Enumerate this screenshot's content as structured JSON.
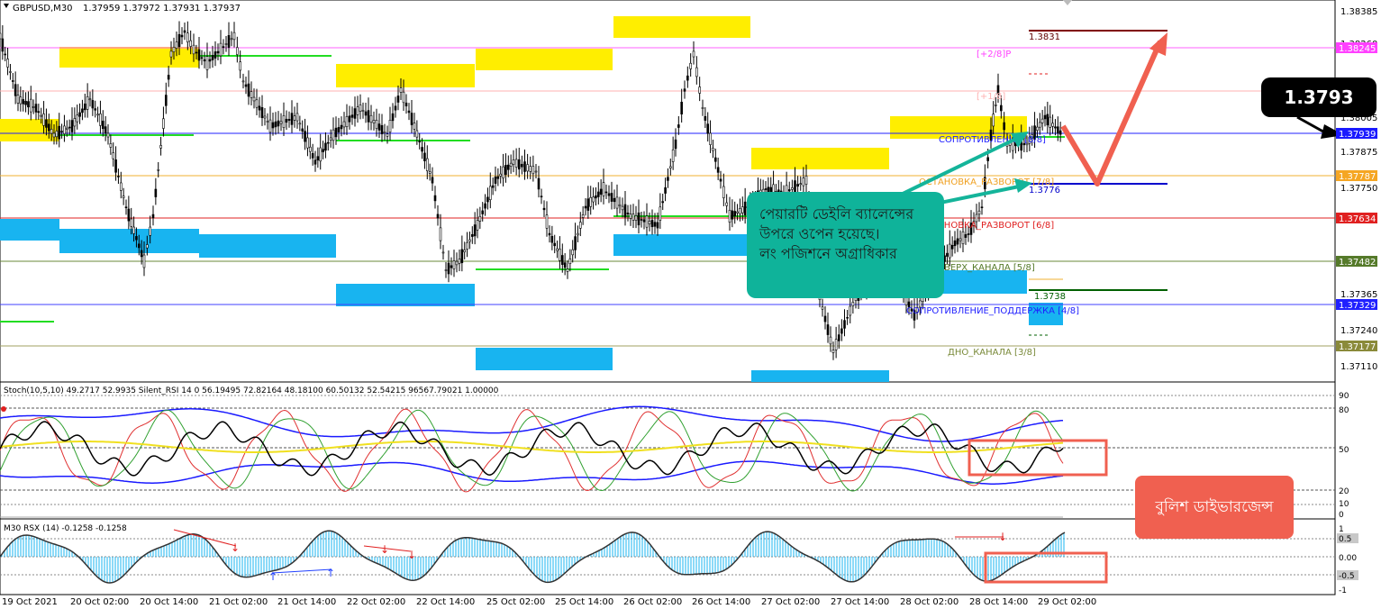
{
  "window": {
    "title": "GBPUSD,M30",
    "ohlc": "1.37959 1.37972 1.37931 1.37937"
  },
  "price_axis": {
    "labels": [
      "1.38385",
      "1.38260",
      "1.38005",
      "1.37875",
      "1.37750",
      "1.37365",
      "1.37240",
      "1.37110"
    ],
    "level_tags": [
      {
        "text": "1.38245",
        "color": "#ff40ff"
      },
      {
        "text": "1.37939",
        "color": "#1a1aff"
      },
      {
        "text": "1.37787",
        "color": "#f5a623"
      },
      {
        "text": "1.37634",
        "color": "#e02020"
      },
      {
        "text": "1.37482",
        "color": "#557a2a"
      },
      {
        "text": "1.37329",
        "color": "#2020ff"
      },
      {
        "text": "1.37177",
        "color": "#8a8a3a"
      }
    ]
  },
  "murrey_labels": {
    "p28": "[+2/8]P",
    "p18": "[+1/8]",
    "resist_8_8": "СОПРОТИВЛЕНИЕ [8/8]",
    "reversal_7_8": "ОСТАНОВКА_РАЗВОРОТ [7/8]",
    "reversal_6_8": "ОСТАНОВКА_РАЗВОРОТ [6/8]",
    "channel_top_5_8": "ВЕРХ_КАНАЛА [5/8]",
    "support_4_8": "СОПРОТИВЛЕНИЕ_ПОДДЕРЖКА [4/8]",
    "channel_bottom_3_8": "ДНО_КАНАЛА [3/8]",
    "level_1_3831": "1.3831",
    "level_1_3776": "1.3776",
    "level_1_3738": "1.3738"
  },
  "indicator1": {
    "header": "Stoch(10,5,10) 49.2717 52.9935  Silent_RSI 14 0 56.19495 72.82164 48.18100 60.50132 52.54215 96567.79021 1.00000",
    "levels": [
      "90",
      "80",
      "50",
      "20",
      "10",
      "0"
    ]
  },
  "indicator2": {
    "header": "M30  RSX (14) -0.1258 -0.1258",
    "levels": [
      "1",
      "0.5",
      "0.00",
      "-0.5",
      "-1"
    ]
  },
  "time_axis": {
    "labels": [
      "19 Oct 2021",
      "20 Oct 02:00",
      "20 Oct 14:00",
      "21 Oct 02:00",
      "21 Oct 14:00",
      "22 Oct 02:00",
      "22 Oct 14:00",
      "25 Oct 02:00",
      "25 Oct 14:00",
      "26 Oct 02:00",
      "26 Oct 14:00",
      "27 Oct 02:00",
      "27 Oct 14:00",
      "28 Oct 02:00",
      "28 Oct 14:00",
      "29 Oct 02:00"
    ]
  },
  "callouts": {
    "main_lines": [
      "পেয়ারটি ডেইলি ব্যালেন্সের",
      "উপরে ওপেন হয়েছে।",
      "লং পজিশনে অগ্রাধিকার"
    ],
    "price": "1.3793",
    "divergence": "বুলিশ ডাইভারজেন্স"
  },
  "colors": {
    "supply_zone": "#ffee00",
    "demand_zone": "#18b4f0",
    "callout_green": "#0fb39a",
    "arrow_red": "#f06050",
    "arrow_teal": "#14b49a",
    "rsx_bars": "#1ab4f0"
  }
}
